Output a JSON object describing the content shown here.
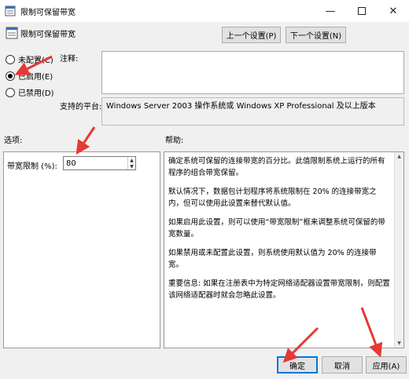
{
  "window": {
    "title": "限制可保留带宽"
  },
  "header": {
    "title": "限制可保留带宽",
    "prev_label": "上一个设置(P)",
    "next_label": "下一个设置(N)"
  },
  "state": {
    "options": [
      {
        "label": "未配置(C)",
        "selected": false
      },
      {
        "label": "已启用(E)",
        "selected": true
      },
      {
        "label": "已禁用(D)",
        "selected": false
      }
    ]
  },
  "comment": {
    "label": "注释:",
    "value": ""
  },
  "supported": {
    "label": "支持的平台:",
    "value": "Windows Server 2003 操作系统或 Windows XP Professional 及以上版本"
  },
  "options_section": {
    "label": "选项:",
    "field_label": "带宽限制 (%):",
    "field_value": "80"
  },
  "help": {
    "label": "帮助:",
    "paragraphs": [
      "确定系统可保留的连接带宽的百分比。此值限制系统上运行的所有程序的组合带宽保留。",
      "默认情况下，数据包计划程序将系统限制在 20% 的连接带宽之内，但可以使用此设置来替代默认值。",
      "如果启用此设置，则可以使用“带宽限制”框来调整系统可保留的带宽数量。",
      "如果禁用或未配置此设置，则系统使用默认值为 20% 的连接带宽。",
      "重要信息: 如果在注册表中为特定网络适配器设置带宽限制，则配置该网络适配器时就会忽略此设置。"
    ]
  },
  "footer": {
    "ok_label": "确定",
    "cancel_label": "取消",
    "apply_label": "应用(A)"
  },
  "colors": {
    "arrow": "#e53935",
    "accent": "#0078d7"
  },
  "icons": {
    "app": "policy-setting-icon",
    "minimize": "minimize-icon",
    "maximize": "maximize-icon",
    "close": "close-icon"
  }
}
